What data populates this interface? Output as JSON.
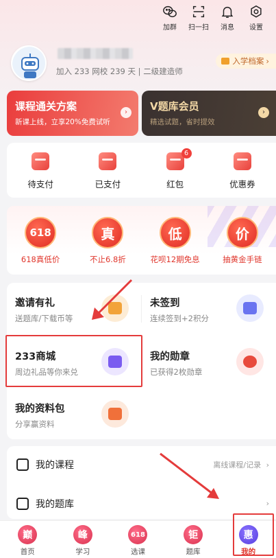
{
  "header": {
    "icons": [
      {
        "icon": "wechat-group-icon",
        "label": "加群"
      },
      {
        "icon": "scan-icon",
        "label": "扫一扫"
      },
      {
        "icon": "bell-icon",
        "label": "消息"
      },
      {
        "icon": "gear-icon",
        "label": "设置"
      }
    ]
  },
  "profile": {
    "sub_info": "加入 233 网校 239 天 | 二级建造师",
    "archive_label": "入学档案",
    "archive_arrow": "›"
  },
  "banners": {
    "course": {
      "title": "课程通关方案",
      "subtitle": "新课上线，立享20%免费试听",
      "arrow": "›"
    },
    "vip": {
      "title": "V题库会员",
      "subtitle": "精选试题，省时提效",
      "arrow": "›"
    }
  },
  "orders": [
    {
      "label": "待支付",
      "icon": "wallet-icon"
    },
    {
      "label": "已支付",
      "icon": "paid-card-icon"
    },
    {
      "label": "红包",
      "icon": "red-envelope-icon",
      "badge": "6"
    },
    {
      "label": "优惠券",
      "icon": "coupon-icon"
    }
  ],
  "promos": [
    {
      "badge": "618",
      "label": "618真低价"
    },
    {
      "badge": "真",
      "label": "不止6.8折"
    },
    {
      "badge": "低",
      "label": "花呗12期免息"
    },
    {
      "badge": "价",
      "label": "抽黄金手链"
    }
  ],
  "services": [
    {
      "title": "邀请有礼",
      "subtitle": "送题库/下载币等",
      "icon": "gift-icon",
      "color": "#fdecd5",
      "inner": "#f2a33a"
    },
    {
      "title": "未签到",
      "subtitle": "连续签到+2积分",
      "icon": "calendar-icon",
      "color": "#e8ebff",
      "inner": "#6a74f0"
    },
    {
      "title": "233商城",
      "subtitle": "周边礼品等你来兑",
      "icon": "shop-icon",
      "color": "#ece6ff",
      "inner": "#7a5cf0"
    },
    {
      "title": "我的勋章",
      "subtitle": "已获得2枚勋章",
      "icon": "medal-icon",
      "color": "#ffe6e4",
      "inner": "#e84a3c"
    },
    {
      "title": "我的资料包",
      "subtitle": "分享赢资料",
      "icon": "pdf-icon",
      "color": "#fde9dc",
      "inner": "#f0703a"
    }
  ],
  "list": {
    "courses": {
      "label": "我的课程",
      "right": "离线课程/记录",
      "arrow": "›"
    },
    "question_bank": {
      "label": "我的题库",
      "arrow": "›"
    }
  },
  "tabbar": [
    {
      "badge": "巅",
      "label": "首页"
    },
    {
      "badge": "峰",
      "label": "学习"
    },
    {
      "badge": "618",
      "label": "选课"
    },
    {
      "badge": "钜",
      "label": "题库"
    },
    {
      "badge": "惠",
      "label": "我的",
      "active": true
    }
  ]
}
